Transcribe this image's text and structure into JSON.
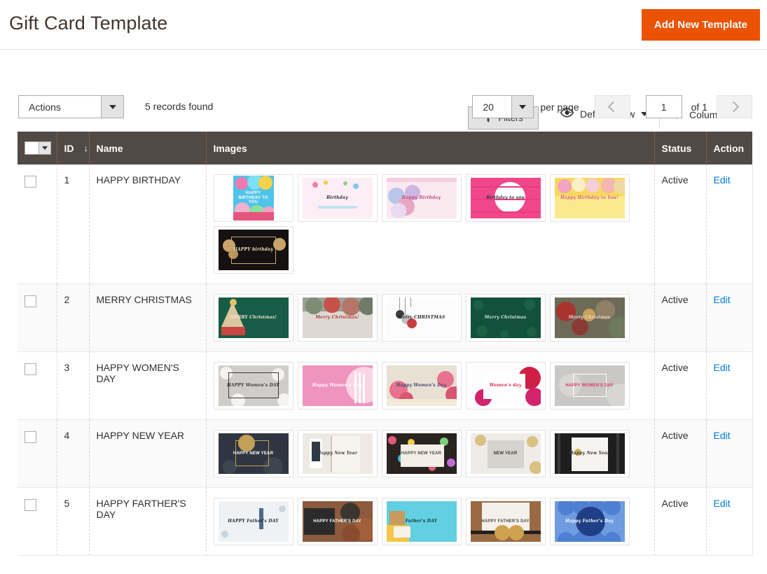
{
  "page": {
    "title": "Gift Card Template",
    "add_button_label": "Add New Template"
  },
  "toolbar": {
    "filters_label": "Filters",
    "view_label": "Default View",
    "columns_label": "Columns",
    "filters_icon": "funnel-icon",
    "view_icon": "eye-icon",
    "columns_icon": "gear-icon"
  },
  "gridcontrols": {
    "actions_label": "Actions",
    "records_found": "5 records found",
    "per_page_value": "20",
    "per_page_label": "per page",
    "page_value": "1",
    "page_of": "of 1",
    "prev_icon": "chevron-left-icon",
    "next_icon": "chevron-right-icon"
  },
  "colors": {
    "accent_orange": "#eb5202",
    "header_brown": "#514943",
    "link_blue": "#007bdb",
    "title_brown": "#41362f"
  },
  "grid": {
    "columns": [
      {
        "key": "check",
        "label": ""
      },
      {
        "key": "id",
        "label": "ID",
        "sort": "↓"
      },
      {
        "key": "name",
        "label": "Name"
      },
      {
        "key": "images",
        "label": "Images"
      },
      {
        "key": "status",
        "label": "Status"
      },
      {
        "key": "action",
        "label": "Action"
      }
    ],
    "rows": [
      {
        "id": "1",
        "name": "HAPPY BIRTHDAY",
        "status": "Active",
        "action": "Edit",
        "images": [
          {
            "caption": "HAPPY BIRTHDAY TO YOU",
            "style": "bday-balloons-blue",
            "orientation": "portrait"
          },
          {
            "caption": "Birthday",
            "style": "bday-pink-lettering",
            "orientation": "landscape"
          },
          {
            "caption": "Happy Birthday",
            "style": "bday-pastel-balloons",
            "orientation": "landscape"
          },
          {
            "caption": "Birthday to you",
            "style": "bday-magenta-balloon",
            "orientation": "landscape"
          },
          {
            "caption": "Happy Birthday to You!",
            "style": "bday-yellow-sweets",
            "orientation": "landscape"
          },
          {
            "caption": "HAPPY birthday",
            "style": "bday-black-gold",
            "orientation": "landscape"
          }
        ]
      },
      {
        "id": "2",
        "name": "MERRY CHRISTMAS",
        "status": "Active",
        "action": "Edit",
        "images": [
          {
            "caption": "MERRY Christmas!",
            "style": "xmas-green-tree",
            "orientation": "landscape"
          },
          {
            "caption": "Merry Christmas!",
            "style": "xmas-gifts-flatlay",
            "orientation": "landscape"
          },
          {
            "caption": "Merry CHRISTMAS",
            "style": "xmas-white-baubles",
            "orientation": "landscape"
          },
          {
            "caption": "Merry Christmas",
            "style": "xmas-dark-green-pattern",
            "orientation": "landscape"
          },
          {
            "caption": "Merry Christmas",
            "style": "xmas-bokeh-red",
            "orientation": "landscape"
          }
        ]
      },
      {
        "id": "3",
        "name": "HAPPY WOMEN'S DAY",
        "status": "Active",
        "action": "Edit",
        "images": [
          {
            "caption": "HAPPY Women's DAY",
            "style": "women-daisies-grey",
            "orientation": "landscape"
          },
          {
            "caption": "Happy Women's Day",
            "style": "women-pink-silhouette",
            "orientation": "landscape"
          },
          {
            "caption": "Happy Women's Day",
            "style": "women-roses-soft",
            "orientation": "landscape"
          },
          {
            "caption": "Women's day",
            "style": "women-red-balloons",
            "orientation": "landscape"
          },
          {
            "caption": "HAPPY WOMEN'S DAY",
            "style": "women-grey-hearts",
            "orientation": "landscape"
          }
        ]
      },
      {
        "id": "4",
        "name": "HAPPY NEW YEAR",
        "status": "Active",
        "action": "Edit",
        "images": [
          {
            "caption": "HAPPY NEW YEAR",
            "style": "ny-navy-gold-frame",
            "orientation": "landscape"
          },
          {
            "caption": "Happy New Year",
            "style": "ny-phone-notebook",
            "orientation": "landscape"
          },
          {
            "caption": "HAPPY NEW YEAR",
            "style": "ny-confetti-card",
            "orientation": "landscape"
          },
          {
            "caption": "NEW YEAR",
            "style": "ny-grey-glitter",
            "orientation": "landscape"
          },
          {
            "caption": "Happy New Year",
            "style": "ny-black-stripes-hands",
            "orientation": "landscape"
          }
        ]
      },
      {
        "id": "5",
        "name": "HAPPY FARTHER'S DAY",
        "status": "Active",
        "action": "Edit",
        "images": [
          {
            "caption": "HAPPY Father's DAY",
            "style": "dad-white-tie-lettering",
            "orientation": "landscape"
          },
          {
            "caption": "HAPPY FATHER'S DAY",
            "style": "dad-chalkboard-shoes",
            "orientation": "landscape"
          },
          {
            "caption": "Father's DAY",
            "style": "dad-teal-gifts",
            "orientation": "landscape"
          },
          {
            "caption": "HAPPY FATHER'S DAY",
            "style": "dad-bowtie-brown",
            "orientation": "landscape"
          },
          {
            "caption": "Happy Father's Day",
            "style": "dad-blue-plaid",
            "orientation": "landscape"
          }
        ]
      }
    ]
  }
}
